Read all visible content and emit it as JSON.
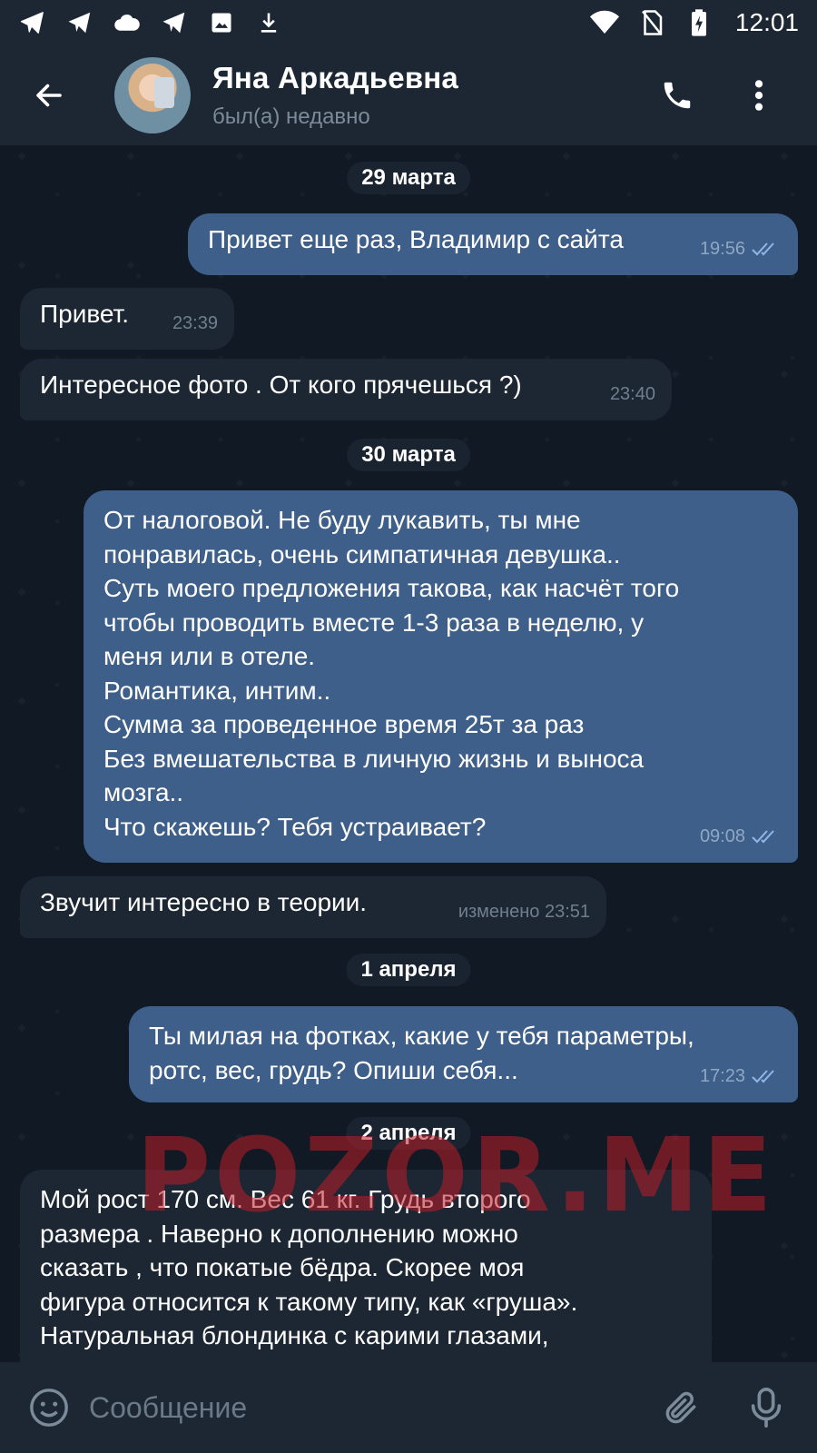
{
  "status_bar": {
    "time": "12:01",
    "left_icons": [
      "telegram-icon",
      "telegram-icon",
      "cloud-icon",
      "telegram-icon",
      "image-icon",
      "download-icon"
    ],
    "right_icons": [
      "wifi-icon",
      "no-sim-icon",
      "battery-charging-icon"
    ]
  },
  "header": {
    "contact_name": "Яна Аркадьевна",
    "contact_status": "был(а) недавно"
  },
  "dates": {
    "d1": "29 марта",
    "d2": "30 марта",
    "d3": "1 апреля",
    "d4": "2 апреля"
  },
  "messages": [
    {
      "direction": "out",
      "text": "Привет еще раз, Владимир с сайта",
      "time": "19:56",
      "read": true
    },
    {
      "direction": "in",
      "text": "Привет.",
      "time": "23:39"
    },
    {
      "direction": "in",
      "text": "Интересное фото . От кого прячешься ?)",
      "time": "23:40"
    },
    {
      "direction": "out",
      "text": "От налоговой. Не буду лукавить, ты мне\nпонравилась, очень симпатичная девушка..\nСуть моего предложения такова, как насчёт того\nчтобы проводить вместе 1-3 раза в неделю, у\nменя или в отеле.\nРомантика, интим..\nСумма за проведенное время 25т за раз\nБез вмешательства в личную жизнь и выноса\nмозга..\nЧто скажешь? Тебя устраивает?",
      "time": "09:08",
      "read": true
    },
    {
      "direction": "in",
      "text": "Звучит интересно в теории.",
      "time": "изменено 23:51"
    },
    {
      "direction": "out",
      "text": "Ты милая на фотках, какие у тебя параметры,\nротс, вес, грудь? Опиши себя...",
      "time": "17:23",
      "read": true
    },
    {
      "direction": "in",
      "text": "Мой рост 170 см. Вес 61 кг. Грудь второго\nразмера . Наверно к дополнению можно\nсказать , что покатые бёдра. Скорее моя\nфигура относится к такому типу, как «груша».\nНатуральная блондинка с карими глазами,",
      "time": ""
    }
  ],
  "watermark": "POZOR.ME",
  "composer": {
    "placeholder": "Сообщение"
  },
  "colors": {
    "header_bg": "#1c2733",
    "chat_bg": "#111a24",
    "outgoing_bubble": "#3e5f8a",
    "incoming_bubble": "#1d2733",
    "read_ticks": "#8fb8e8"
  }
}
